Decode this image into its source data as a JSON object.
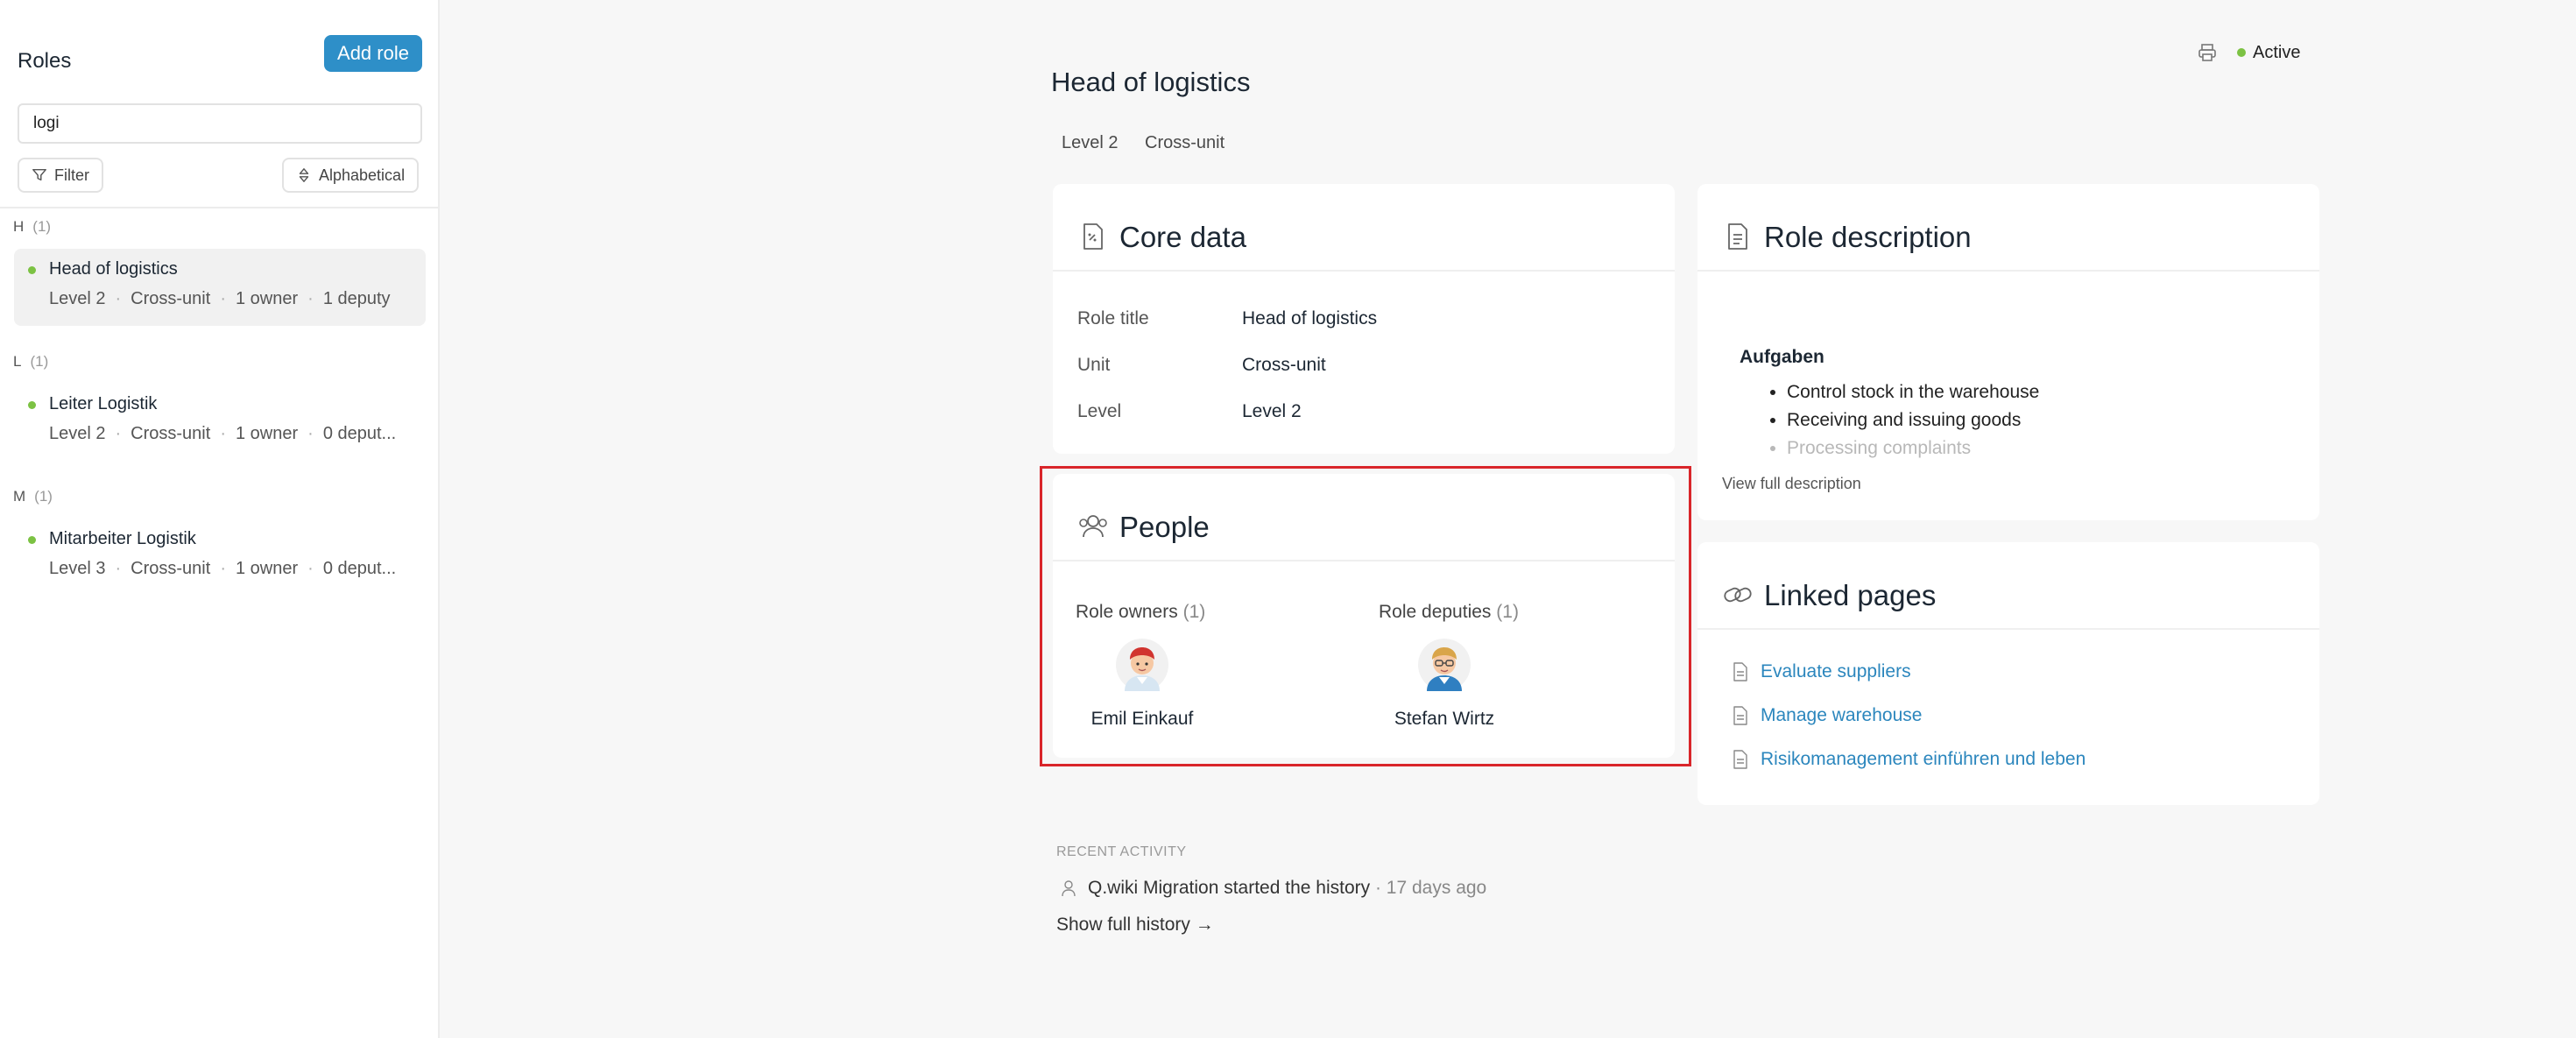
{
  "sidebar": {
    "title": "Roles",
    "add_role_label": "Add role",
    "search_value": "logi",
    "filter_label": "Filter",
    "sort_label": "Alphabetical",
    "groups": [
      {
        "letter": "H",
        "count": "(1)",
        "items": [
          {
            "name": "Head of logistics",
            "level": "Level 2",
            "unit": "Cross-unit",
            "owners": "1 owner",
            "deputies": "1 deputy"
          }
        ]
      },
      {
        "letter": "L",
        "count": "(1)",
        "items": [
          {
            "name": "Leiter Logistik",
            "level": "Level 2",
            "unit": "Cross-unit",
            "owners": "1 owner",
            "deputies": "0 deput..."
          }
        ]
      },
      {
        "letter": "M",
        "count": "(1)",
        "items": [
          {
            "name": "Mitarbeiter Logistik",
            "level": "Level 3",
            "unit": "Cross-unit",
            "owners": "1 owner",
            "deputies": "0 deput..."
          }
        ]
      }
    ]
  },
  "main": {
    "title": "Head of logistics",
    "tags": [
      "Level 2",
      "Cross-unit"
    ],
    "status": "Active",
    "core_data": {
      "title": "Core data",
      "rows": [
        {
          "label": "Role title",
          "value": "Head of logistics"
        },
        {
          "label": "Unit",
          "value": "Cross-unit"
        },
        {
          "label": "Level",
          "value": "Level 2"
        }
      ]
    },
    "role_description": {
      "title": "Role description",
      "heading": "Aufgaben",
      "items": [
        "Control stock in the warehouse",
        "Receiving and issuing goods",
        "Processing complaints"
      ],
      "view_full": "View full description"
    },
    "people": {
      "title": "People",
      "owners_label": "Role owners",
      "owners_count": "(1)",
      "owner_name": "Emil Einkauf",
      "deputies_label": "Role deputies",
      "deputies_count": "(1)",
      "deputy_name": "Stefan Wirtz"
    },
    "linked_pages": {
      "title": "Linked pages",
      "items": [
        "Evaluate suppliers",
        "Manage warehouse",
        "Risikomanagement einführen und leben"
      ]
    },
    "recent": {
      "heading": "RECENT ACTIVITY",
      "actor": "Q.wiki Migration",
      "action": "started the history",
      "time": "· 17 days ago",
      "show_history": "Show full history →"
    }
  },
  "colors": {
    "accent": "#2e8fc8",
    "status_green": "#7cc243",
    "link": "#2b86bd",
    "highlight": "#d9252a"
  }
}
